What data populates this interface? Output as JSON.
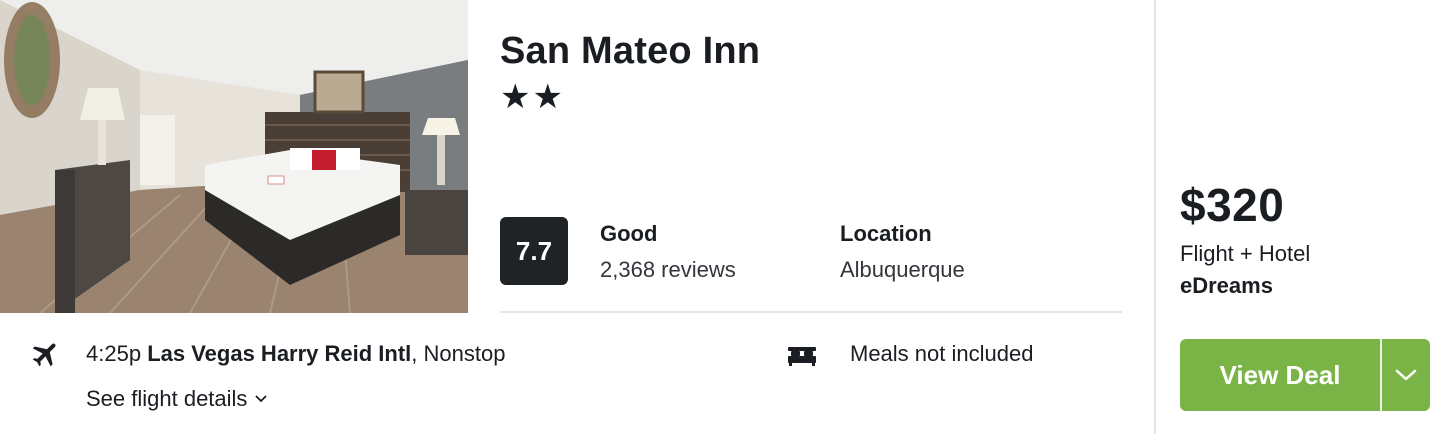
{
  "hotel": {
    "name": "San Mateo Inn",
    "stars_display": "★★",
    "star_count": 2,
    "photo_icon": "hotel-room-photo"
  },
  "rating": {
    "score": "7.7",
    "label": "Good",
    "reviews": "2,368 reviews"
  },
  "location": {
    "label": "Location",
    "value": "Albuquerque"
  },
  "flight": {
    "icon": "airplane-icon",
    "time": "4:25p",
    "airport": "Las Vegas Harry Reid Intl",
    "stops": ", Nonstop",
    "details_link": "See flight details",
    "details_icon": "chevron-down-icon"
  },
  "amenities": {
    "icon": "bed-icon",
    "meals": "Meals not included"
  },
  "offer": {
    "price": "$320",
    "package": "Flight + Hotel",
    "provider": "eDreams",
    "button_label": "View Deal",
    "button_more_icon": "chevron-down-icon",
    "button_color": "#7bb446"
  }
}
